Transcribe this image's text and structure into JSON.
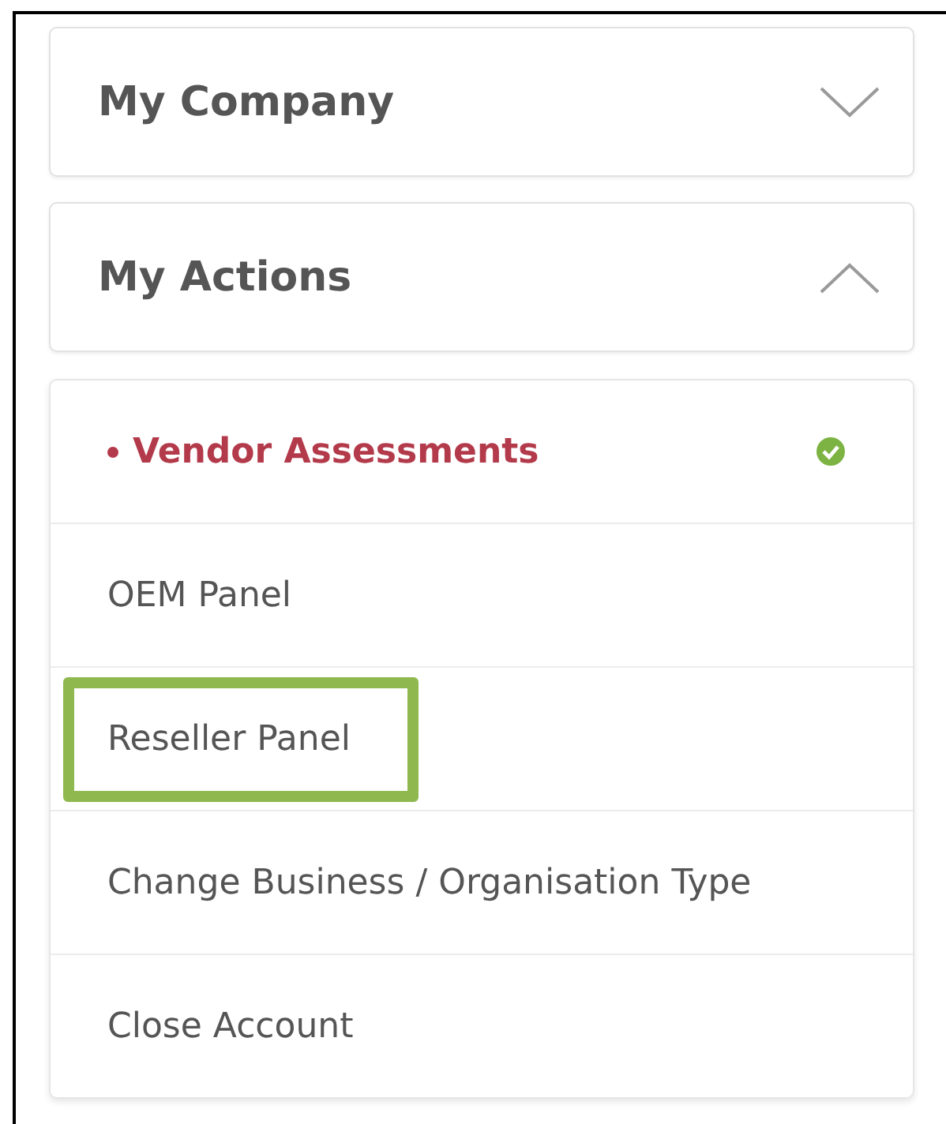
{
  "sections": [
    {
      "title": "My Company",
      "expanded": false
    },
    {
      "title": "My Actions",
      "expanded": true
    }
  ],
  "menu_items": [
    {
      "label": "Vendor Assessments",
      "selected": true,
      "highlighted": false
    },
    {
      "label": "OEM Panel",
      "selected": false,
      "highlighted": false
    },
    {
      "label": "Reseller Panel",
      "selected": false,
      "highlighted": true
    },
    {
      "label": "Change Business / Organisation Type",
      "selected": false,
      "highlighted": false
    },
    {
      "label": "Close Account",
      "selected": false,
      "highlighted": false
    }
  ]
}
